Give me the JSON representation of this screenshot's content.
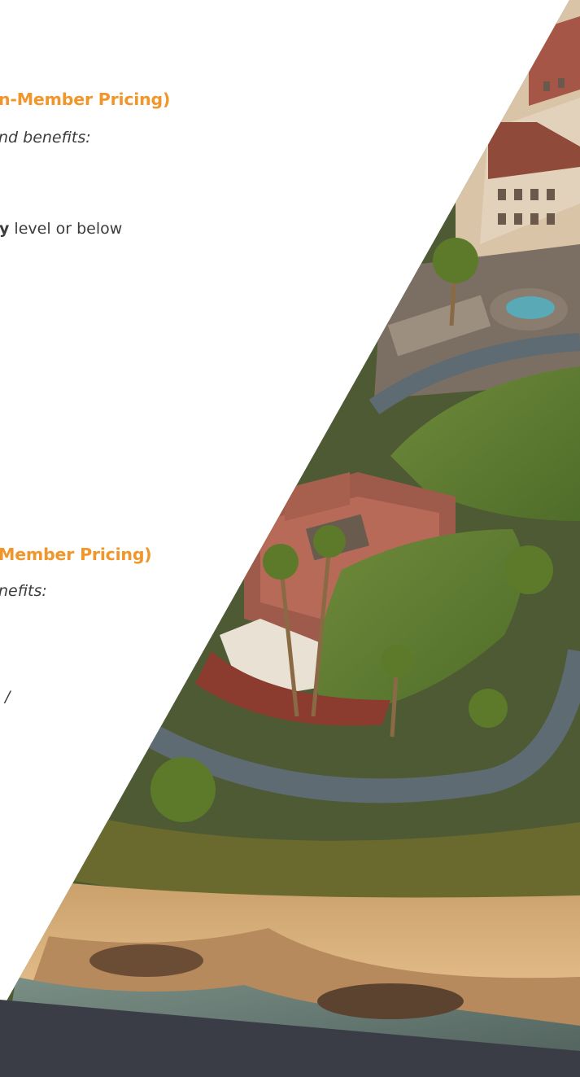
{
  "colors": {
    "accent": "#F0962A",
    "body_text": "#3C3C3C",
    "footer": "#3A3D45"
  },
  "section1": {
    "heading": "n-Member Pricing)",
    "intro": "nd benefits:",
    "line_bold": "y",
    "line_rest": " level or below"
  },
  "section2": {
    "heading": "Member Pricing)",
    "intro": "nefits:",
    "fragment": "/"
  }
}
